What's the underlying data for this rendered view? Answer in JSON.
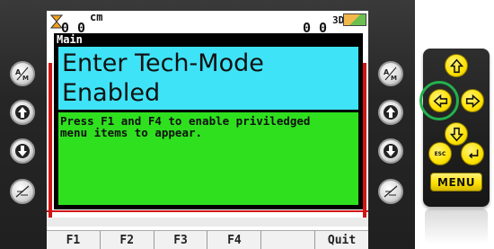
{
  "dialog": {
    "title": "Main",
    "heading": "Enter Tech-Mode Enabled",
    "body": "Press F1 and F4 to enable priviledged\nmenu items to appear."
  },
  "status_bar": {
    "unit": "cm",
    "right_label": "3D"
  },
  "function_keys": [
    "F1",
    "F2",
    "F3",
    "F4",
    "",
    "Quit"
  ],
  "keypad": {
    "menu_label": "MENU",
    "esc_label": "ESC",
    "highlighted_button": "left"
  },
  "colors": {
    "dialog_heading_bg": "#3fe3f7",
    "dialog_body_bg": "#2fe01f",
    "keypad_button": "#ffe200",
    "highlight_ring": "#22b14c",
    "accent_red": "#d01515"
  },
  "icons": {
    "side_left": [
      "am-icon",
      "up-arrow-icon",
      "down-arrow-icon",
      "backlight-icon"
    ],
    "side_right": [
      "am-icon",
      "up-arrow-icon",
      "down-arrow-icon",
      "backlight-icon"
    ],
    "keypad": [
      "up-arrow-icon",
      "left-arrow-icon",
      "right-arrow-icon",
      "down-arrow-icon",
      "esc-icon",
      "enter-icon"
    ]
  }
}
